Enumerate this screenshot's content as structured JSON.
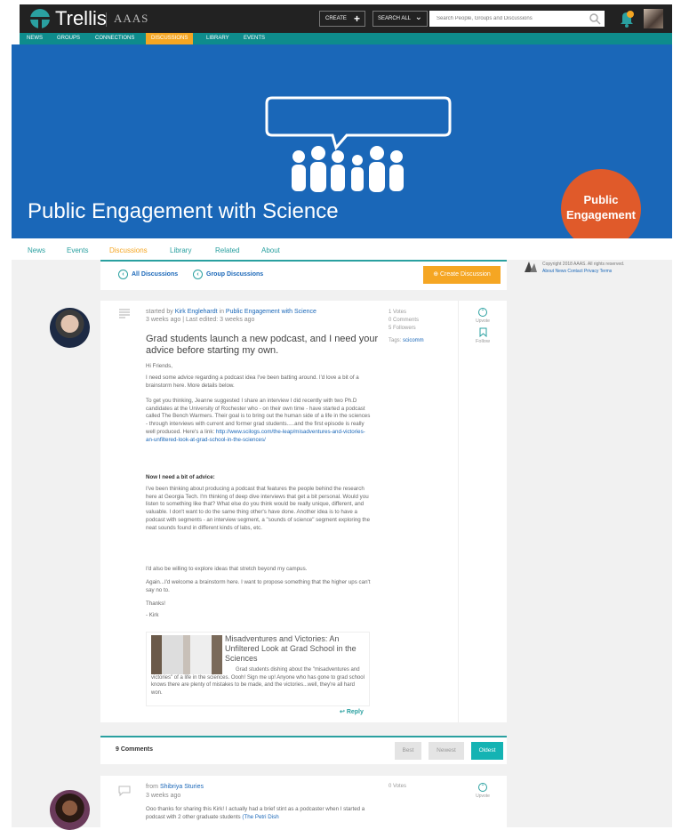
{
  "header": {
    "brand": "Trellis",
    "org": "AAAS",
    "create_label": "CREATE",
    "search_all_label": "SEARCH ALL",
    "search_placeholder": "Search People, Groups and Discussions"
  },
  "nav": {
    "items": [
      "NEWS",
      "GROUPS",
      "CONNECTIONS",
      "DISCUSSIONS",
      "LIBRARY",
      "EVENTS"
    ],
    "active": "DISCUSSIONS"
  },
  "banner": {
    "title": "Public Engagement with Science",
    "badge_line1": "Public",
    "badge_line2": "Engagement",
    "color": "#1a67b8",
    "badge_color": "#e05a2a"
  },
  "subnav": {
    "items": [
      "News",
      "Events",
      "Discussions",
      "Library",
      "Related",
      "About"
    ],
    "active": "Discussions"
  },
  "discussions_bar": {
    "all_label": "All Discussions",
    "group_label": "Group Discussions",
    "create_label": "Create Discussion"
  },
  "footer": {
    "copyright": "Copyright 2018 AAAS. All rights reserved.",
    "links": "About  News  Contact  Privacy  Terms"
  },
  "post": {
    "started_by_prefix": "started by",
    "author": "Kirk Englehardt",
    "in_word": "in",
    "group": "Public Engagement with Science",
    "time": "3 weeks ago | Last edited: 3 weeks ago",
    "title": "Grad students launch a new podcast, and I need your advice before starting my own.",
    "greeting": "Hi Friends,",
    "p1": "I need some advice regarding a podcast idea I've been batting around. I'd love a bit of a brainstorm here. More details below.",
    "p2": "To get you thinking, Jeanne suggested I share an interview I did recently with two Ph.D candidates at the University of Rochester who - on their own time - have started a podcast called The Bench Warmers. Their goal is to bring out the human side of a life in the sciences - through interviews with current and former grad students.....and the first episode is really well produced. Here's a link:",
    "p2_link": "http://www.scilogs.com/the-leap/misadventures-and-victories-an-unfiltered-look-at-grad-school-in-the-sciences/",
    "subhead": "Now I need a bit of advice:",
    "p3": "I've been thinking about producing a podcast that features the people behind the research here at Georgia Tech. I'm thinking of deep dive interviews that get a bit personal. Would you listen to something like that? What else do you think would be really unique, different, and valuable. I don't want to do the same thing other's have done. Another idea is to have a podcast with segments - an interview segment, a \"sounds of science\" segment exploring the neat sounds found in different kinds of labs, etc.",
    "p4": "I'd also be willing to explore ideas that stretch beyond my campus.",
    "p5": "Again...I'd welcome a brainstorm here. I want to propose something that the higher ups can't say no to.",
    "thanks": "Thanks!",
    "sign": "- Kirk",
    "stats": [
      "1 Votes",
      "0 Comments",
      "5 Followers"
    ],
    "tags_label": "Tags:",
    "tag": "scicomm",
    "upvote_label": "Upvote",
    "follow_label": "Follow",
    "reply_label": "Reply",
    "card": {
      "title": "Misadventures and Victories: An Unfiltered Look at Grad School in the Sciences",
      "desc": "Grad students dishing about the \"misadventures and victories\" of a life in the sciences. Oooh! Sign me up! Anyone who has gone to grad school knows there are plenty of mistakes to be made, and the victories...well, they're all hard won."
    }
  },
  "comments": {
    "count_label": "9 Comments",
    "sort": [
      "Best",
      "Newest",
      "Oldest"
    ],
    "active_sort": "Oldest"
  },
  "comment": {
    "from_prefix": "from",
    "author": "Shibriya Sturies",
    "time": "3 weeks ago",
    "votes": "0 Votes",
    "upvote_label": "Upvote",
    "text": "Ooo thanks for sharing this Kirk! I actually had a brief stint as a podcaster when I started a podcast with 2 other graduate students",
    "link": "(The Petri Dish"
  }
}
